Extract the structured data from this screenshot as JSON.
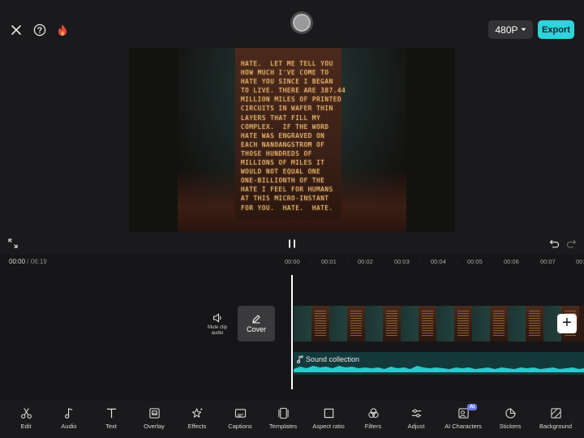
{
  "topbar": {
    "resolution_label": "480P",
    "export_label": "Export",
    "icons": [
      "close-icon",
      "help-icon",
      "fire-icon",
      "record-icon",
      "chevron-down-icon"
    ]
  },
  "preview": {
    "overlay_text": "HATE.  LET ME TELL YOU\nHOW MUCH I'VE COME TO\nHATE YOU SINCE I BEGAN\nTO LIVE. THERE ARE 387.44\nMILLION MILES OF PRINTED\nCIRCUITS IN WAFER THIN\nLAYERS THAT FILL MY\nCOMPLEX.  IF THE WORD\nHATE WAS ENGRAVED ON\nEACH NANOANGSTROM OF\nTHOSE HUNDREDS OF\nMILLIONS OF MILES IT\nWOULD NOT EQUAL ONE\nONE-BILLIONTH OF THE\nHATE I FEEL FOR HUMANS\nAT THIS MICRO-INSTANT\nFOR YOU.  HATE.  HATE."
  },
  "playback": {
    "current_time": "00:00",
    "separator": "/",
    "total_time": "06:19"
  },
  "ruler": {
    "ticks": [
      "00:00",
      "00:01",
      "00:02",
      "00:03",
      "00:04",
      "00:05",
      "00:06",
      "00:07",
      "00:0"
    ]
  },
  "tracks": {
    "mute_label": "Mute clip\naudio",
    "cover_label": "Cover",
    "audio_label": "Sound collection"
  },
  "toolbar": {
    "items": [
      {
        "label": "Edit",
        "icon": "scissors-icon"
      },
      {
        "label": "Audio",
        "icon": "music-note-icon"
      },
      {
        "label": "Text",
        "icon": "text-icon"
      },
      {
        "label": "Overlay",
        "icon": "overlay-icon"
      },
      {
        "label": "Effects",
        "icon": "effects-icon"
      },
      {
        "label": "Captions",
        "icon": "captions-icon"
      },
      {
        "label": "Templates",
        "icon": "templates-icon"
      },
      {
        "label": "Aspect ratio",
        "icon": "aspect-ratio-icon"
      },
      {
        "label": "Filters",
        "icon": "filters-icon"
      },
      {
        "label": "Adjust",
        "icon": "adjust-icon"
      },
      {
        "label": "AI Characters",
        "icon": "ai-characters-icon",
        "badge": "AI"
      },
      {
        "label": "Stickers",
        "icon": "stickers-icon"
      },
      {
        "label": "Background",
        "icon": "background-icon"
      }
    ]
  },
  "colors": {
    "accent": "#2fd3dc",
    "background": "#1a1a1c",
    "waveform": "#2ec8cf",
    "ai_badge": "#6f7af0"
  }
}
